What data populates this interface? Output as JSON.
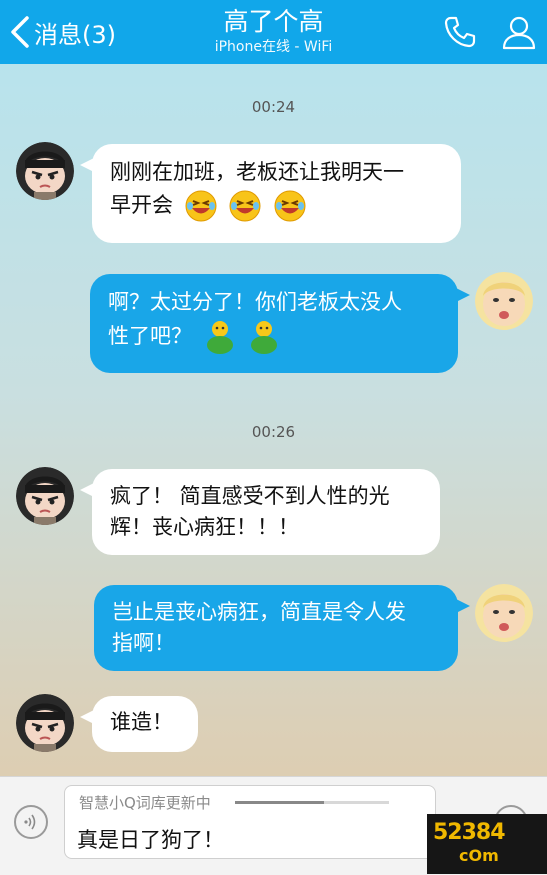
{
  "header": {
    "back_label": "消息(3)",
    "title": "高了个高",
    "subtitle": "iPhone在线 - WiFi",
    "call_icon": "phone-icon",
    "profile_icon": "person-icon"
  },
  "messages": [
    {
      "type": "time",
      "text": "00:24"
    },
    {
      "type": "incoming",
      "text_line1": "刚刚在加班，老板还让我明天一",
      "text_line2": "早开会",
      "emojis": [
        "laughing-tears-emoji",
        "laughing-tears-emoji",
        "laughing-tears-emoji"
      ]
    },
    {
      "type": "outgoing",
      "text_line1": "啊？太过分了！你们老板太没人",
      "text_line2": "性了吧？",
      "emojis": [
        "green-frog-emoji",
        "green-frog-emoji"
      ]
    },
    {
      "type": "time",
      "text": "00:26"
    },
    {
      "type": "incoming",
      "text_line1": "疯了！ 简直感受不到人性的光",
      "text_line2": "辉！丧心病狂！！！"
    },
    {
      "type": "outgoing",
      "text_line1": "岂止是丧心病狂，简直是令人发",
      "text_line2": "指啊！"
    },
    {
      "type": "incoming",
      "text_line1": "谁造！"
    }
  ],
  "input": {
    "hint": "智慧小Q词库更新中",
    "progress": 0.58,
    "value": "真是日了狗了！"
  },
  "watermark": {
    "line1": "52384",
    "line2": "cOm"
  },
  "colors": {
    "header": "#11a7ea",
    "outgoing_bubble": "#19a6e8",
    "incoming_bubble": "#ffffff"
  }
}
